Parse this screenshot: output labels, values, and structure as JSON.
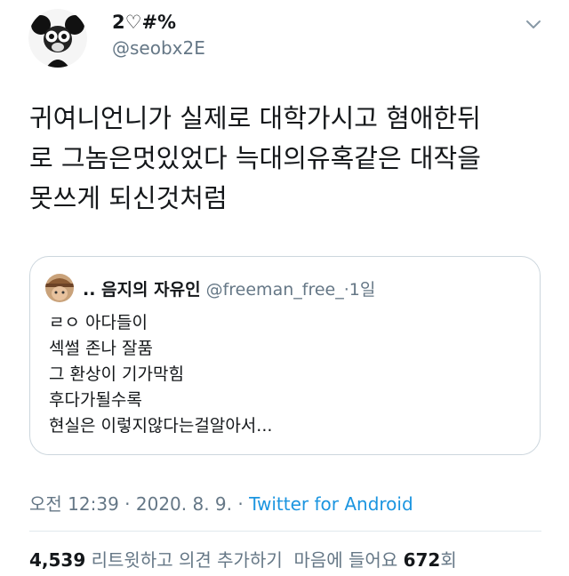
{
  "author": {
    "name": "2♡#%",
    "handle": "@seobx2E",
    "avatar_icon": "cartoon-mouse-avatar"
  },
  "tweet": {
    "text": "귀여니언니가 실제로 대학가시고 혐애한뒤\n로 그놈은멋있었다 늑대의유혹같은 대작을\n못쓰게 되신것처럼"
  },
  "quoted": {
    "name": ".. 음지의 자유인",
    "handle": "@freeman_free_",
    "sep": "·",
    "time": "1일",
    "avatar_icon": "hat-person-avatar",
    "text": "ㄹㅇ 아다들이\n섹썰 존나 잘품\n그 환상이 기가막힘\n후다가될수록\n현실은 이렇지않다는걸알아서..."
  },
  "meta": {
    "time": "오전 12:39",
    "sep1": "·",
    "date": "2020. 8. 9.",
    "sep2": "·",
    "source": "Twitter for Android"
  },
  "stats": {
    "retweets_count": "4,539",
    "retweets_label": "리트윗하고 의견 추가하기",
    "likes_label": "마음에 들어요",
    "likes_count": "672",
    "likes_suffix": "회"
  },
  "colors": {
    "text": "#14171a",
    "secondary": "#657786",
    "link": "#1b95e0",
    "border": "#ccd6dd"
  }
}
